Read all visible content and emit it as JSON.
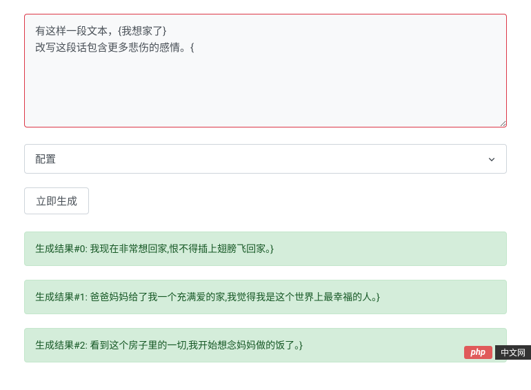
{
  "input": {
    "text": "有这样一段文本，{我想家了}\n改写这段话包含更多悲伤的感情。{"
  },
  "config": {
    "label": "配置"
  },
  "button": {
    "generate": "立即生成"
  },
  "results": [
    "生成结果#0: 我现在非常想回家,恨不得插上翅膀飞回家。}",
    "生成结果#1: 爸爸妈妈给了我一个充满爱的家,我觉得我是这个世界上最幸福的人。}",
    "生成结果#2: 看到这个房子里的一切,我开始想念妈妈做的饭了。}"
  ],
  "watermark": {
    "badge": "php",
    "text": "中文网"
  }
}
